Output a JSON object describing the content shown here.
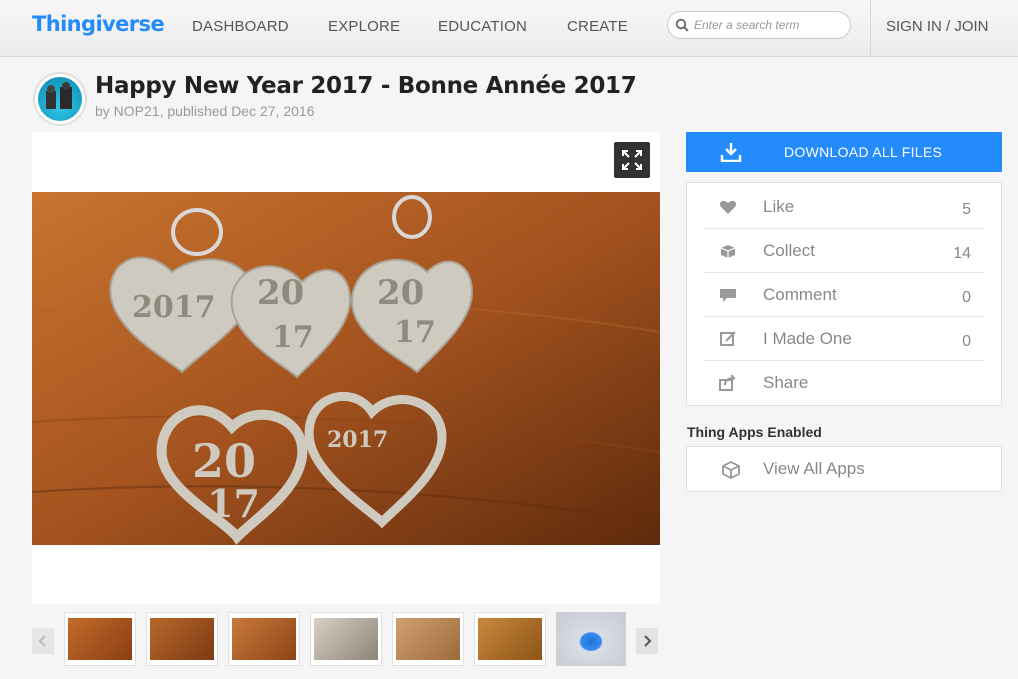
{
  "header": {
    "logo": "Thingiverse",
    "nav": [
      "DASHBOARD",
      "EXPLORE",
      "EDUCATION",
      "CREATE"
    ],
    "search_placeholder": "Enter a search term",
    "signin": "SIGN IN / JOIN",
    "accent": "#248bfb"
  },
  "thing": {
    "title": "Happy New Year 2017 - Bonne Année 2017",
    "byline": "by NOP21, published Dec 27, 2016",
    "photo_text": [
      "2017",
      "20",
      "17",
      "20",
      "17",
      "20",
      "17",
      "2017"
    ]
  },
  "actions": {
    "download_label": "DOWNLOAD ALL FILES",
    "stats": [
      {
        "label": "Like",
        "count": "5",
        "icon": "heart-icon"
      },
      {
        "label": "Collect",
        "count": "14",
        "icon": "collect-icon"
      },
      {
        "label": "Comment",
        "count": "0",
        "icon": "comment-icon"
      },
      {
        "label": "I Made One",
        "count": "0",
        "icon": "made-icon"
      },
      {
        "label": "Share",
        "count": "",
        "icon": "share-icon"
      }
    ],
    "apps_title": "Thing Apps Enabled",
    "apps_link": "View All Apps"
  }
}
